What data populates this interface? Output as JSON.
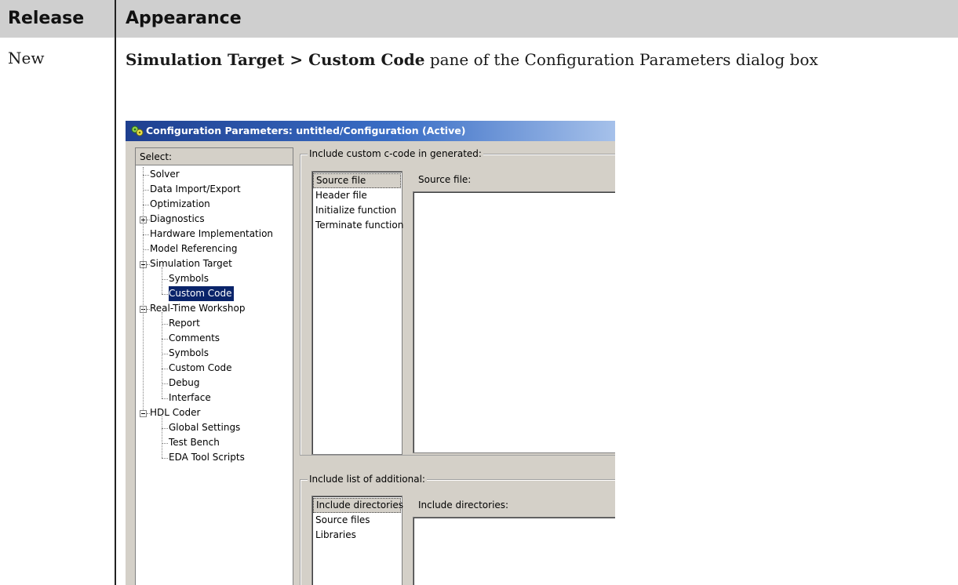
{
  "table": {
    "header_release": "Release",
    "header_appearance": "Appearance",
    "row_release": "New",
    "row_desc_bold": "Simulation Target > Custom Code",
    "row_desc_rest": " pane of the Configuration Parameters dialog box"
  },
  "dialog": {
    "title": "Configuration Parameters: untitled/Configuration (Active)",
    "select_label": "Select:",
    "tree": [
      {
        "label": "Solver"
      },
      {
        "label": "Data Import/Export"
      },
      {
        "label": "Optimization"
      },
      {
        "label": "Diagnostics"
      },
      {
        "label": "Hardware Implementation"
      },
      {
        "label": "Model Referencing"
      },
      {
        "label": "Simulation Target"
      },
      {
        "label": "Symbols"
      },
      {
        "label": "Custom Code",
        "selected": true
      },
      {
        "label": "Real-Time Workshop"
      },
      {
        "label": "Report"
      },
      {
        "label": "Comments"
      },
      {
        "label": "Symbols"
      },
      {
        "label": "Custom Code"
      },
      {
        "label": "Debug"
      },
      {
        "label": "Interface"
      },
      {
        "label": "HDL Coder"
      },
      {
        "label": "Global Settings"
      },
      {
        "label": "Test Bench"
      },
      {
        "label": "EDA Tool Scripts"
      }
    ],
    "custom_code_group": {
      "label": "Include custom c-code in generated:",
      "items": [
        "Source file",
        "Header file",
        "Initialize function",
        "Terminate function"
      ],
      "field_label": "Source file:"
    },
    "additional_group": {
      "label": "Include list of additional:",
      "items": [
        "Include directories",
        "Source files",
        "Libraries"
      ],
      "field_label": "Include directories:"
    }
  },
  "colors": {
    "header_bg": "#cfcfcf",
    "selection": "#0a246a",
    "dialog_bg": "#d4d0c8"
  }
}
